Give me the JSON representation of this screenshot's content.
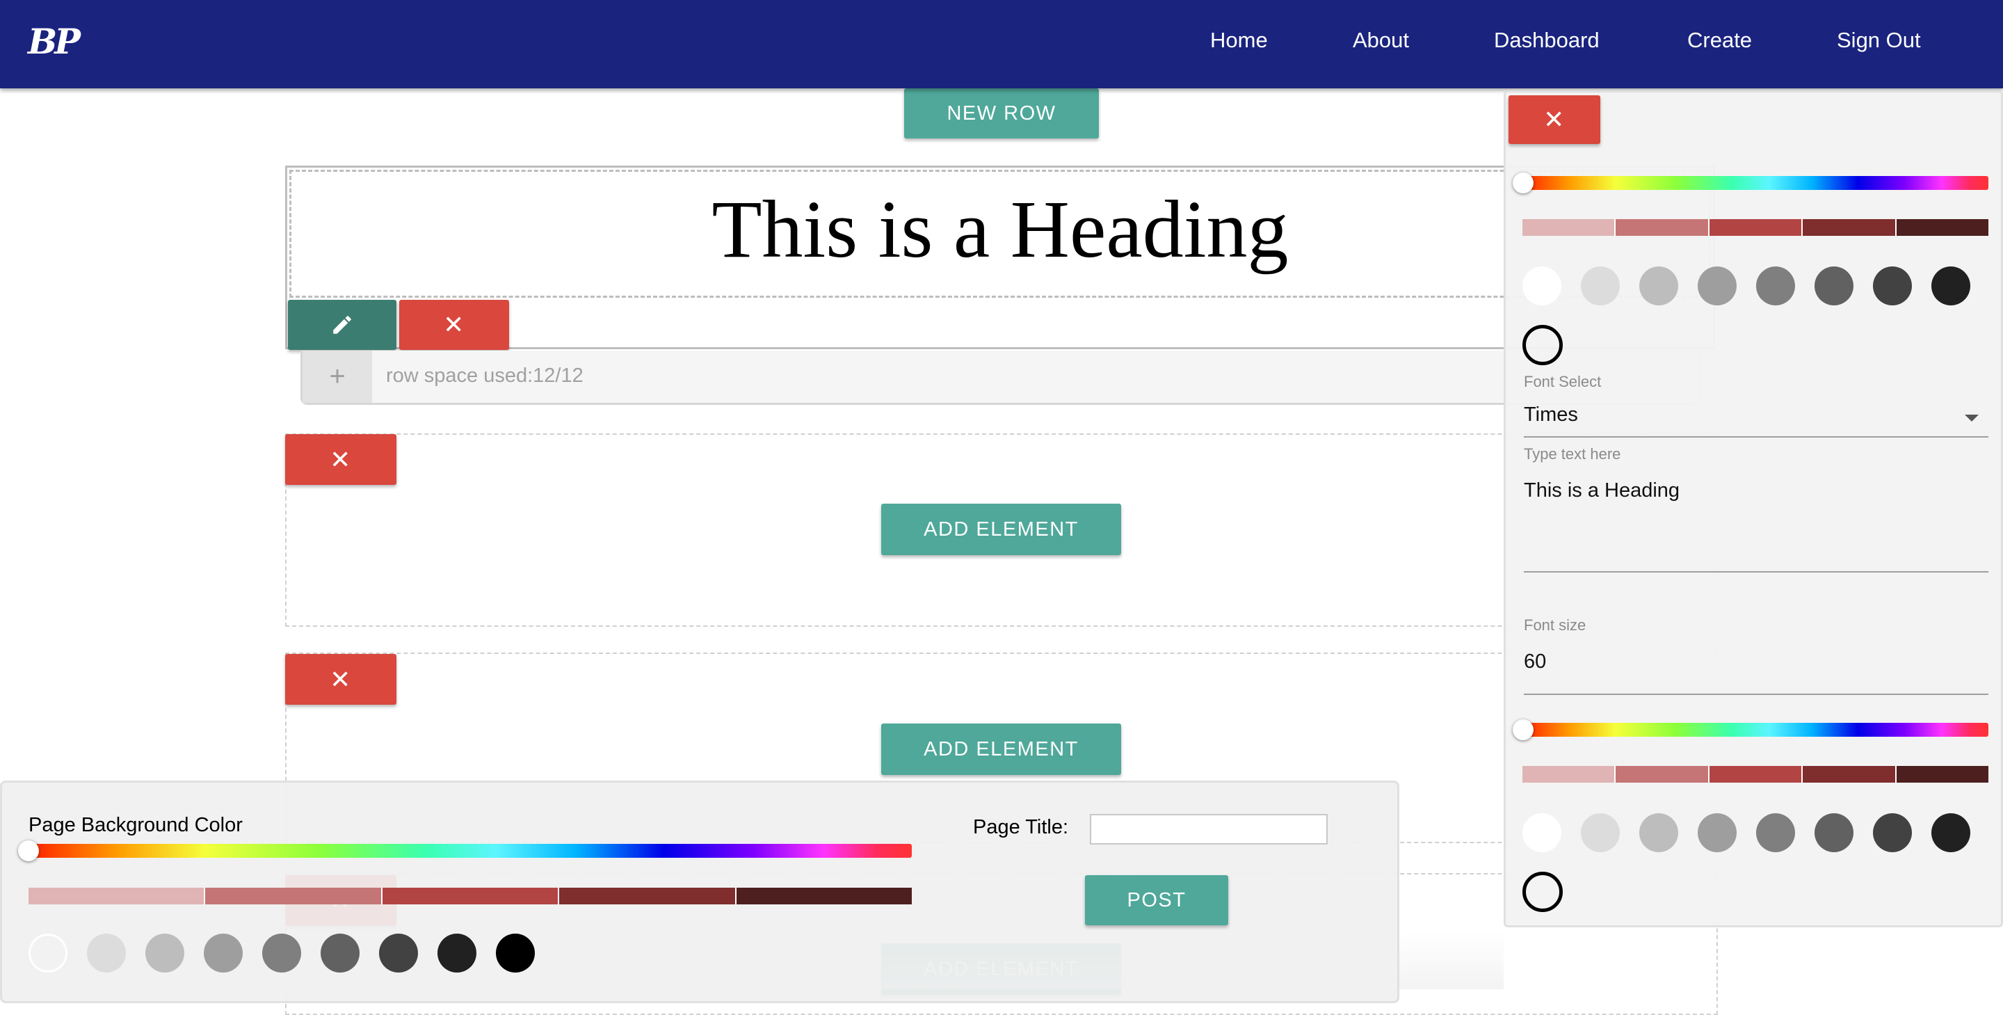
{
  "nav": {
    "logo": "BP",
    "links": [
      "Home",
      "About",
      "Dashboard",
      "Create",
      "Sign Out"
    ]
  },
  "editor": {
    "new_row_label": "NEW ROW",
    "heading_text": "This is a Heading",
    "row_space_text": "row space used:12/12",
    "add_element_label": "ADD ELEMENT",
    "plus_symbol": "+",
    "delete_symbol": "✕",
    "edit_icon": "pencil-icon"
  },
  "page_settings": {
    "bg_color_label": "Page Background Color",
    "page_title_label": "Page Title:",
    "page_title_value": "",
    "post_label": "POST",
    "hue_position": 0,
    "shades": [
      "#e0b4b4",
      "#c57575",
      "#b34444",
      "#7f2d2d",
      "#4d1f1f"
    ],
    "grays": [
      "#f2f2f2",
      "#dcdcdc",
      "#bdbdbd",
      "#9e9e9e",
      "#7f7f7f",
      "#616161",
      "#424242",
      "#212121",
      "#000000"
    ]
  },
  "element_settings": {
    "close_symbol": "✕",
    "shades": [
      "#e0b4b4",
      "#c57575",
      "#b34444",
      "#7f2d2d",
      "#4d1f1f"
    ],
    "grays": [
      "#ffffff",
      "#dcdcdc",
      "#bdbdbd",
      "#9e9e9e",
      "#7f7f7f",
      "#616161",
      "#424242",
      "#212121"
    ],
    "font_select_label": "Font Select",
    "font_value": "Times",
    "text_label": "Type text here",
    "text_value": "This is a Heading",
    "font_size_label": "Font size",
    "font_size_value": "60"
  },
  "colors": {
    "navbar": "#1a237e",
    "teal": "#4fa89a",
    "red": "#d9473d",
    "dark_teal": "#3c7d71"
  }
}
